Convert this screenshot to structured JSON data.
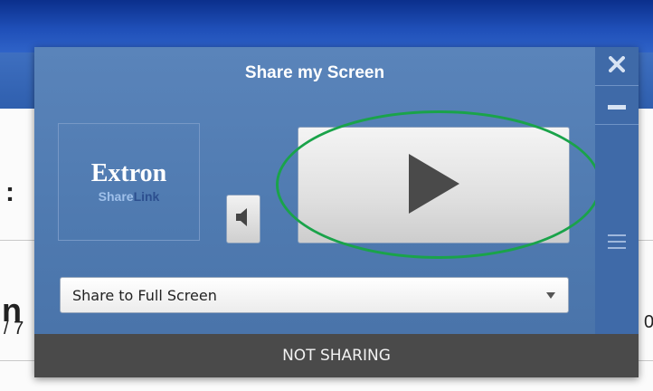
{
  "background": {
    "fragments": [
      ":",
      "n",
      "/ 7",
      "0"
    ]
  },
  "popup": {
    "title": "Share my Screen",
    "logo": {
      "brand": "Extron",
      "product_part1": "Share",
      "product_part2": "Link"
    },
    "side_buttons": {
      "close_icon": "close-icon",
      "minimize_icon": "minimize-icon",
      "menu_icon": "menu-icon"
    },
    "speaker_icon": "speaker-icon",
    "play_icon": "play-icon",
    "share_select": {
      "value": "Share to Full Screen"
    },
    "status": "NOT SHARING"
  },
  "colors": {
    "panel": "#5a84ba",
    "status_bar": "#4a4a4a",
    "highlight": "#1aa34a"
  }
}
